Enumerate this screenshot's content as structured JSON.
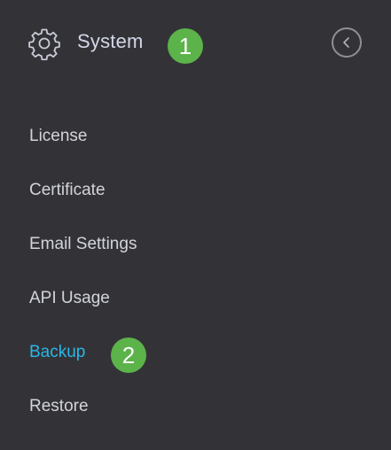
{
  "header": {
    "title": "System",
    "icon": "gear-icon",
    "collapse_icon": "chevron-left-icon"
  },
  "callouts": {
    "step1": "1",
    "step2": "2",
    "color": "#5cb34a"
  },
  "menu": {
    "items": [
      {
        "label": "License"
      },
      {
        "label": "Certificate"
      },
      {
        "label": "Email Settings"
      },
      {
        "label": "API Usage"
      },
      {
        "label": "Backup",
        "active": true
      },
      {
        "label": "Restore"
      }
    ],
    "active_color": "#29b6e8"
  }
}
